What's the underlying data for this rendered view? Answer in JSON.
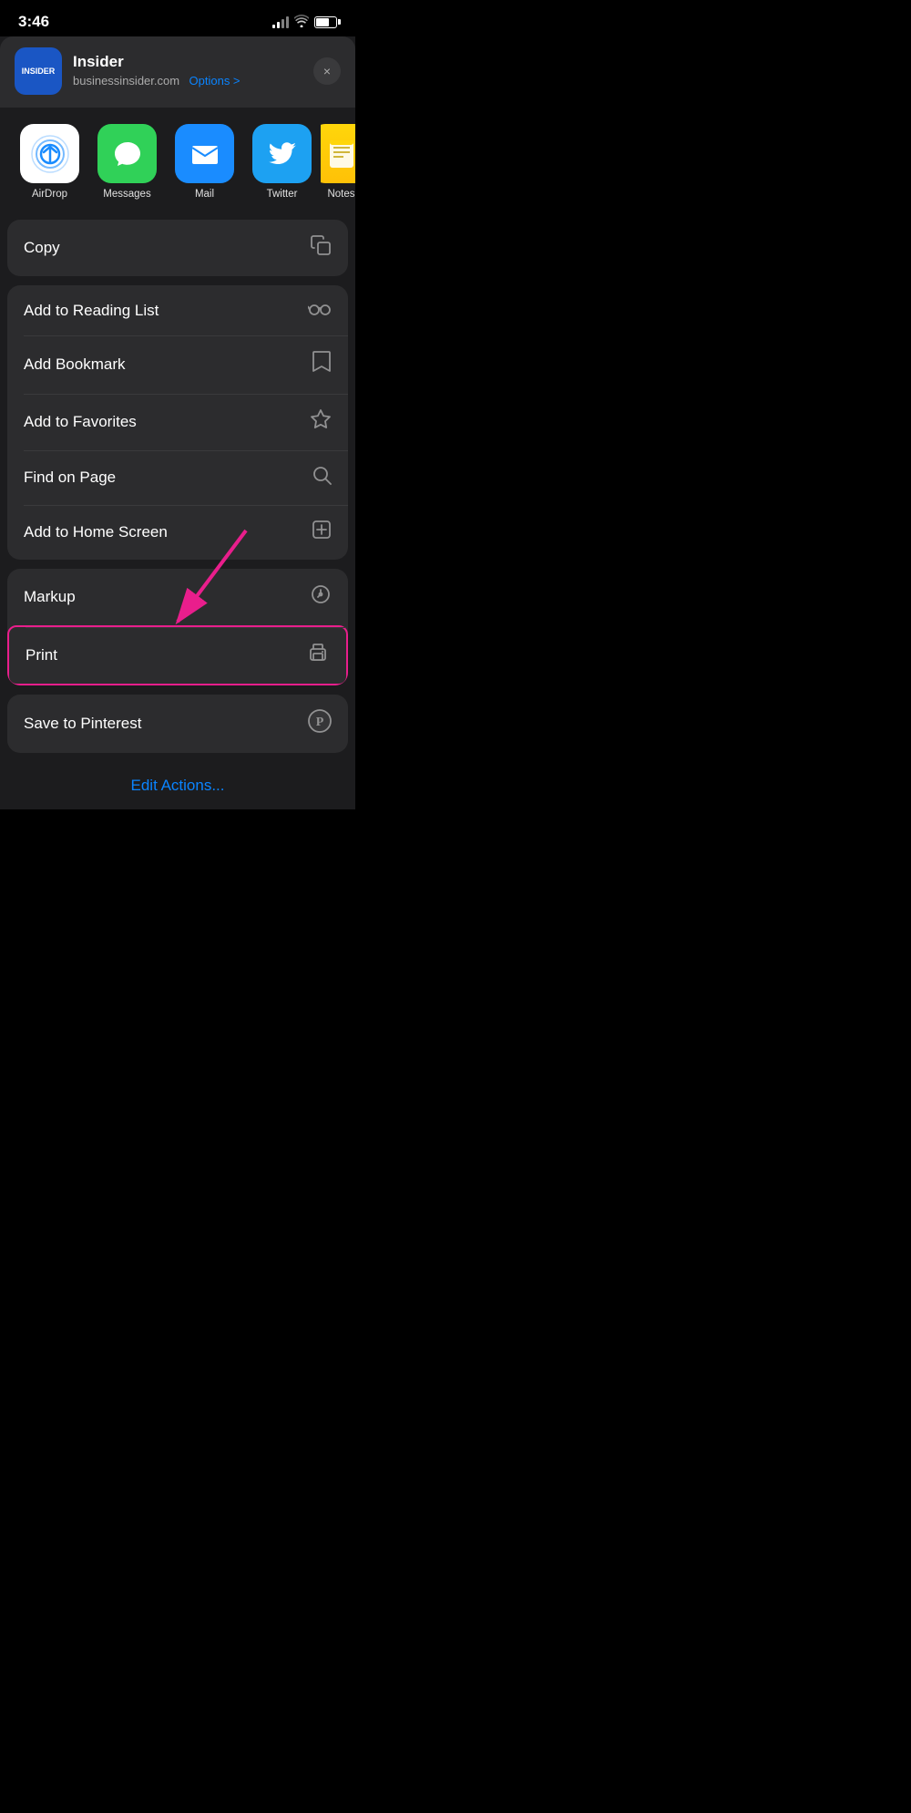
{
  "statusBar": {
    "time": "3:46"
  },
  "header": {
    "siteIconText": "INSIDER",
    "siteName": "Insider",
    "siteUrl": "businessinsider.com",
    "optionsLabel": "Options >",
    "closeLabel": "×"
  },
  "apps": [
    {
      "id": "airdrop",
      "label": "AirDrop",
      "iconType": "airdrop"
    },
    {
      "id": "messages",
      "label": "Messages",
      "iconType": "messages"
    },
    {
      "id": "mail",
      "label": "Mail",
      "iconType": "mail"
    },
    {
      "id": "twitter",
      "label": "Twitter",
      "iconType": "twitter"
    },
    {
      "id": "notes",
      "label": "Notes",
      "iconType": "notes"
    }
  ],
  "actions": {
    "group1": [
      {
        "id": "copy",
        "label": "Copy",
        "icon": "copy"
      }
    ],
    "group2": [
      {
        "id": "add-reading-list",
        "label": "Add to Reading List",
        "icon": "glasses"
      },
      {
        "id": "add-bookmark",
        "label": "Add Bookmark",
        "icon": "bookmark"
      },
      {
        "id": "add-favorites",
        "label": "Add to Favorites",
        "icon": "star"
      },
      {
        "id": "find-on-page",
        "label": "Find on Page",
        "icon": "search"
      },
      {
        "id": "add-home-screen",
        "label": "Add to Home Screen",
        "icon": "add-square"
      }
    ],
    "group3": [
      {
        "id": "markup",
        "label": "Markup",
        "icon": "markup"
      },
      {
        "id": "print",
        "label": "Print",
        "icon": "print"
      }
    ],
    "group4": [
      {
        "id": "save-pinterest",
        "label": "Save to Pinterest",
        "icon": "pinterest"
      }
    ]
  },
  "editActions": "Edit Actions..."
}
